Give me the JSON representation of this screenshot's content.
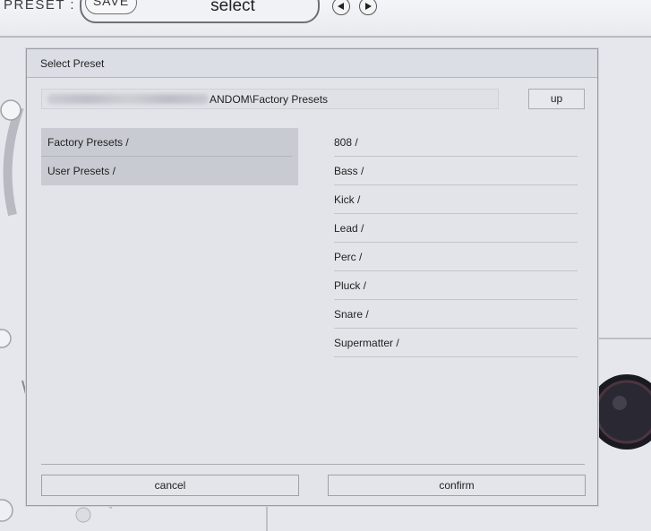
{
  "header": {
    "preset_label": "PRESET :",
    "save_label": "SAVE",
    "preset_name": "select",
    "prev_icon": "arrow-left-icon",
    "next_icon": "arrow-right-icon"
  },
  "dialog": {
    "title": "Select Preset",
    "path_visible_text": "ANDOM\\Factory Presets",
    "up_label": "up",
    "left_items": [
      {
        "label": "Factory Presets /"
      },
      {
        "label": "User Presets /"
      }
    ],
    "right_items": [
      {
        "label": "808 /"
      },
      {
        "label": "Bass /"
      },
      {
        "label": "Kick /"
      },
      {
        "label": "Lead /"
      },
      {
        "label": "Perc /"
      },
      {
        "label": "Pluck /"
      },
      {
        "label": "Snare /"
      },
      {
        "label": "Supermatter /"
      }
    ],
    "cancel_label": "cancel",
    "confirm_label": "confirm"
  },
  "colors": {
    "background": "#e6e7ec",
    "dialog_bg": "#e2e4ea",
    "selected_list_bg": "#c9cbd2",
    "text": "#222222"
  }
}
